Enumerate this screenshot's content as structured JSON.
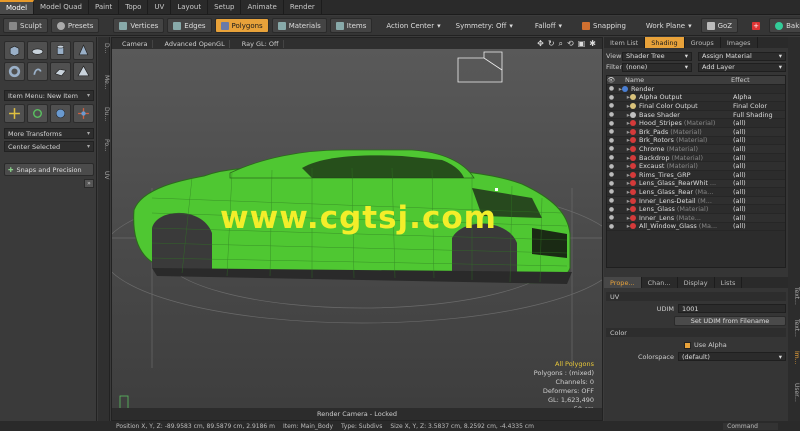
{
  "top_tabs": [
    "Model",
    "Model Quad",
    "Paint",
    "Topo",
    "UV",
    "Layout",
    "Setup",
    "Animate",
    "Render"
  ],
  "active_tab": "Model",
  "toolbar": {
    "sculpt": "Sculpt",
    "presets": "Presets",
    "vertices": "Vertices",
    "edges": "Edges",
    "polygons": "Polygons",
    "materials": "Materials",
    "items": "Items",
    "action_center": "Action Center",
    "symmetry": "Symmetry: Off",
    "falloff": "Falloff",
    "snapping": "Snapping",
    "work_plane": "Work Plane",
    "goz": "GoZ",
    "baking": "Baking UI"
  },
  "left_panel": {
    "item_menu": "Item Menu: New Item",
    "more_transforms": "More Transforms",
    "center_selected": "Center Selected",
    "snaps": "Snaps and Precision"
  },
  "left_strip": [
    "D...",
    "Me...",
    "Du...",
    "Po...",
    "UV"
  ],
  "viewport": {
    "camera": "Camera",
    "shading": "Advanced OpenGL",
    "raygl": "Ray GL: Off",
    "footer": "Render Camera - Locked",
    "stats": {
      "mode": "All Polygons",
      "polygons": "Polygons : (mixed)",
      "channels": "Channels: 0",
      "deformers": "Deformers: OFF",
      "gl": "GL: 1,623,490",
      "scale": "50 cm"
    },
    "watermark": "www.cgtsj.com",
    "car_color": "#4fc732"
  },
  "shader_panel": {
    "tabs": [
      "Item List",
      "Shading",
      "Groups",
      "Images"
    ],
    "active": "Shading",
    "view_label": "View",
    "view_value": "Shader Tree",
    "assign": "Assign Material",
    "filter_label": "Filter",
    "filter_value": "(none)",
    "add_layer": "Add Layer",
    "col_name": "Name",
    "col_effect": "Effect",
    "rows": [
      {
        "indent": 0,
        "name": "Render",
        "tag": "",
        "effect": "",
        "color": "#4a7fd4"
      },
      {
        "indent": 1,
        "name": "Alpha Output",
        "tag": "",
        "effect": "Alpha",
        "color": "#d9c27a"
      },
      {
        "indent": 1,
        "name": "Final Color Output",
        "tag": "",
        "effect": "Final Color",
        "color": "#d9c27a"
      },
      {
        "indent": 1,
        "name": "Base Shader",
        "tag": "",
        "effect": "Full Shading",
        "color": "#bfbfbf"
      },
      {
        "indent": 1,
        "name": "Hood_Stripes",
        "tag": "(Material)",
        "effect": "(all)",
        "color": "#d43a3a"
      },
      {
        "indent": 1,
        "name": "Brk_Pads",
        "tag": "(Material)",
        "effect": "(all)",
        "color": "#d43a3a"
      },
      {
        "indent": 1,
        "name": "Brk_Rotors",
        "tag": "(Material)",
        "effect": "(all)",
        "color": "#d43a3a"
      },
      {
        "indent": 1,
        "name": "Chrome",
        "tag": "(Material)",
        "effect": "(all)",
        "color": "#d43a3a"
      },
      {
        "indent": 1,
        "name": "Backdrop",
        "tag": "(Material)",
        "effect": "(all)",
        "color": "#d43a3a"
      },
      {
        "indent": 1,
        "name": "Excaust",
        "tag": "(Material)",
        "effect": "(all)",
        "color": "#d43a3a"
      },
      {
        "indent": 1,
        "name": "Rims_Tires_GRP",
        "tag": "",
        "effect": "(all)",
        "color": "#d43a3a"
      },
      {
        "indent": 1,
        "name": "Lens_Glass_RearWhit",
        "tag": "...",
        "effect": "(all)",
        "color": "#d43a3a"
      },
      {
        "indent": 1,
        "name": "Lens_Glass_Rear",
        "tag": "(Ma...",
        "effect": "(all)",
        "color": "#d43a3a"
      },
      {
        "indent": 1,
        "name": "Inner_Lens-Detail",
        "tag": "(M...",
        "effect": "(all)",
        "color": "#d43a3a"
      },
      {
        "indent": 1,
        "name": "Lens_Glass",
        "tag": "(Material)",
        "effect": "(all)",
        "color": "#d43a3a"
      },
      {
        "indent": 1,
        "name": "Inner_Lens",
        "tag": "(Mate...",
        "effect": "(all)",
        "color": "#d43a3a"
      },
      {
        "indent": 1,
        "name": "All_Window_Glass",
        "tag": "(Ma...",
        "effect": "(all)",
        "color": "#d43a3a"
      }
    ]
  },
  "properties": {
    "tabs": [
      "Prope...",
      "Chan...",
      "Display",
      "Lists"
    ],
    "active": "Prope...",
    "uv_section": "UV",
    "udim_label": "UDIM",
    "udim_value": "1001",
    "set_udim": "Set UDIM from Filename",
    "color_section": "Color",
    "use_alpha": "Use Alpha",
    "colorspace_label": "Colorspace",
    "colorspace_value": "(default)"
  },
  "right_strip": [
    "Text...",
    "Text...",
    "Im...",
    "User..."
  ],
  "status_bar": {
    "position": "Position X, Y, Z:   -89.9583 cm, 89.5879 cm, 2.9186 m",
    "item": "Item:  Main_Body",
    "type": "Type:  Subdivs",
    "size": "Size X, Y, Z:   3.5837 cm, 8.2592 cm, -4.4335 cm",
    "command": "Command"
  }
}
